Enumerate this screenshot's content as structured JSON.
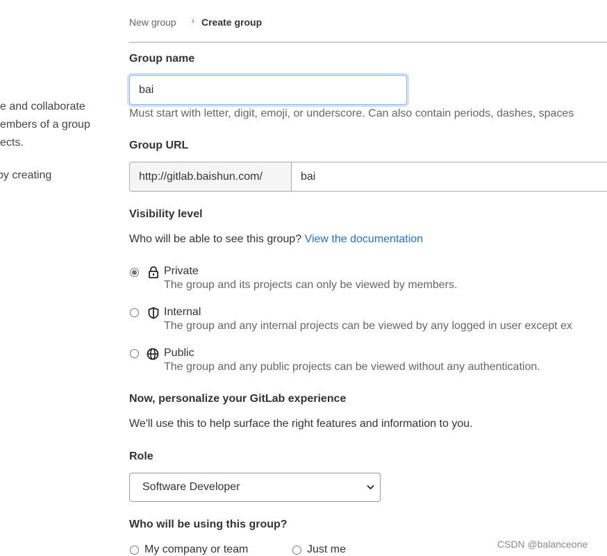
{
  "sidebar": {
    "lines": [
      "e and collaborate",
      "embers of a group",
      "ects.",
      "by creating"
    ]
  },
  "breadcrumb": {
    "parent": "New group",
    "separator": "›",
    "current": "Create group"
  },
  "group_name": {
    "label": "Group name",
    "value": "bai",
    "help": "Must start with letter, digit, emoji, or underscore. Can also contain periods, dashes, spaces"
  },
  "group_url": {
    "label": "Group URL",
    "prefix": "http://gitlab.baishun.com/",
    "value": "bai"
  },
  "visibility": {
    "label": "Visibility level",
    "question": "Who will be able to see this group?",
    "doc_link": "View the documentation",
    "options": [
      {
        "label": "Private",
        "description": "The group and its projects can only be viewed by members.",
        "icon": "lock-icon",
        "selected": true
      },
      {
        "label": "Internal",
        "description": "The group and any internal projects can be viewed by any logged in user except ex",
        "icon": "shield-icon",
        "selected": false
      },
      {
        "label": "Public",
        "description": "The group and any public projects can be viewed without any authentication.",
        "icon": "globe-icon",
        "selected": false
      }
    ]
  },
  "personalize": {
    "title": "Now, personalize your GitLab experience",
    "subtitle": "We'll use this to help surface the right features and information to you."
  },
  "role": {
    "label": "Role",
    "selected": "Software Developer"
  },
  "usage": {
    "label": "Who will be using this group?",
    "options": [
      "My company or team",
      "Just me"
    ]
  },
  "watermark": "CSDN @balanceone",
  "colors": {
    "link": "#1f75cb",
    "focus": "#9cc6f5"
  }
}
